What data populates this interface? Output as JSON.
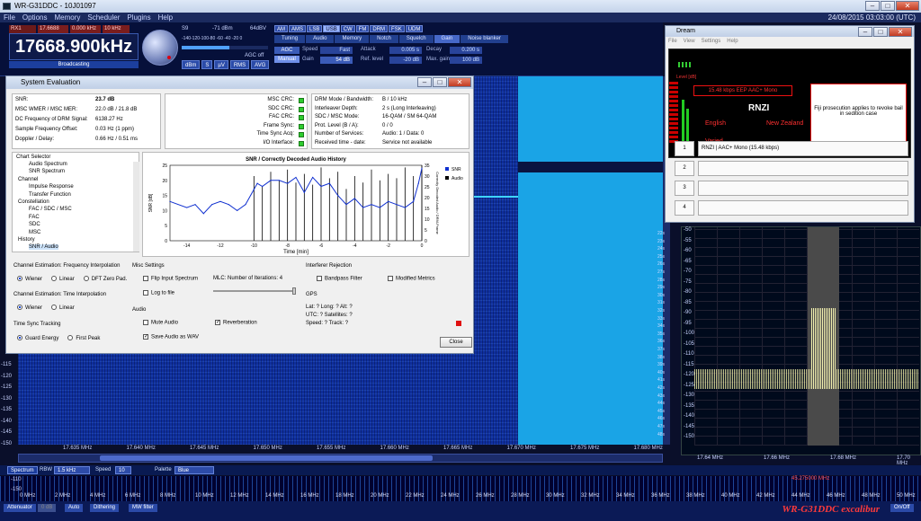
{
  "window": {
    "title": "WR-G31DDC - 10J01097"
  },
  "menu": [
    "File",
    "Options",
    "Memory",
    "Scheduler",
    "Plugins",
    "Help"
  ],
  "datetime": "24/08/2015 03:03:00 (UTC)",
  "receiver": {
    "rx": "RX1",
    "rx2": "17.6688 MHz",
    "rx3": "0.000 kHz",
    "rx4": "10 kHz",
    "frequency": "17668.900kHz",
    "state": "Broadcasting",
    "s_label": "S9",
    "dbm": "-71 dBm",
    "dbuv": "64dBV",
    "smeter_ticks": "-140-120-100-80 -60 -40 -20 0",
    "agc_off": "AGC off",
    "meter_buttons": [
      "dBm",
      "S",
      "µV",
      "RMS",
      "AVG"
    ]
  },
  "modes": [
    "AM",
    "AMS",
    "LSB",
    "USB",
    "CW",
    "FM",
    "DRM",
    "FSK",
    "UDM"
  ],
  "active_mode": "USB",
  "tabs": [
    "Tuning",
    "Audio",
    "Memory",
    "Notch",
    "Squelch",
    "Gain",
    "Noise blanker"
  ],
  "active_tab": "Gain",
  "gain": {
    "agc": "AGC",
    "manual": "Manual",
    "speed_label": "Speed",
    "speed": "Fast",
    "attack_label": "Attack",
    "attack": "0.005 s",
    "decay_label": "Decay",
    "decay": "0.200 s",
    "gain_label": "Gain",
    "gain": "54 dB",
    "reflevel_label": "Ref. level",
    "reflevel": "-20 dB",
    "maxgain_label": "Max. gain",
    "maxgain": "100 dB"
  },
  "waterfall": {
    "yticks": [
      "-115",
      "-120",
      "-125",
      "-130",
      "-135",
      "-140",
      "-145",
      "-150"
    ],
    "xticks": [
      "17.635 MHz",
      "17.640 MHz",
      "17.645 MHz",
      "17.650 MHz",
      "17.655 MHz",
      "17.660 MHz",
      "17.665 MHz",
      "17.670 MHz",
      "17.675 MHz",
      "17.680 MHz"
    ],
    "timeticks": [
      "22s",
      "23s",
      "24s",
      "25s",
      "26s",
      "27s",
      "28s",
      "29s",
      "30s",
      "31s",
      "32s",
      "33s",
      "34s",
      "35s",
      "36s",
      "37s",
      "38s",
      "39s",
      "40s",
      "41s",
      "42s",
      "43s",
      "44s",
      "45s",
      "46s",
      "47s",
      "48s"
    ]
  },
  "rightspectrum": {
    "yticks": [
      "-50",
      "-55",
      "-60",
      "-65",
      "-70",
      "-75",
      "-80",
      "-85",
      "-90",
      "-95",
      "-100",
      "-105",
      "-110",
      "-115",
      "-120",
      "-125",
      "-130",
      "-135",
      "-140",
      "-145",
      "-150"
    ],
    "xticks": [
      "17.64 MHz",
      "17.66 MHz",
      "17.68 MHz",
      "17.70 MHz"
    ]
  },
  "bottom": {
    "spectrum": "Spectrum",
    "rbw_label": "RBW",
    "rbw": "1.5 kHz",
    "speed_label": "Speed",
    "speed": "10",
    "palette_label": "Palette",
    "palette": "Blue",
    "strip_ticks": [
      "0 MHz",
      "2 MHz",
      "4 MHz",
      "6 MHz",
      "8 MHz",
      "10 MHz",
      "12 MHz",
      "14 MHz",
      "16 MHz",
      "18 MHz",
      "20 MHz",
      "22 MHz",
      "24 MHz",
      "26 MHz",
      "28 MHz",
      "30 MHz",
      "32 MHz",
      "34 MHz",
      "36 MHz",
      "38 MHz",
      "40 MHz",
      "42 MHz",
      "44 MHz",
      "46 MHz",
      "48 MHz",
      "50 MHz"
    ],
    "strip_marker": "45.275000 MHz",
    "strip_y": [
      "-110",
      "-150"
    ],
    "attenuator": "Attenuator",
    "att_val": "0 dB",
    "auto": "Auto",
    "dithering": "Dithering",
    "mwfilter": "MW filter",
    "onoff": "On/Off",
    "brand": "WR-G31DDC excalibur"
  },
  "sysdlg": {
    "title": "System Evaluation",
    "left": [
      [
        "SNR:",
        "23.7 dB"
      ],
      [
        "MSC WMER / MSC MER:",
        "22.0 dB / 21.8 dB"
      ],
      [
        "DC Frequency of DRM Signal:",
        "6138.27 Hz"
      ],
      [
        "Sample Frequency Offset:",
        "0.03 Hz (1 ppm)"
      ],
      [
        "Doppler / Delay:",
        "0.66 Hz / 0.51 ms"
      ]
    ],
    "crc": [
      "MSC CRC:",
      "SDC CRC:",
      "FAC CRC:",
      "Frame Sync:",
      "Time Sync Acq:",
      "I/O Interface:"
    ],
    "right": [
      [
        "DRM Mode / Bandwidth:",
        "B / 10 kHz"
      ],
      [
        "Interleaver Depth:",
        "2 s (Long Interleaving)"
      ],
      [
        "SDC / MSC Mode:",
        "16-QAM / SM 64-QAM"
      ],
      [
        "Prot. Level (B / A):",
        "0 / 0"
      ],
      [
        "Number of Services:",
        "Audio: 1 / Data: 0"
      ],
      [
        "Received time - date:",
        "Service not available"
      ]
    ],
    "tree_title": "Chart Selector",
    "tree": [
      "Audio Spectrum",
      "SNR Spectrum",
      "Channel",
      "Impulse Response",
      "Transfer Function",
      "Constellation",
      "FAC / SDC / MSC",
      "FAC",
      "SDC",
      "MSC",
      "History",
      "SNR / Audio"
    ],
    "chart": {
      "title": "SNR / Correctly Decoded Audio History",
      "ylabel": "SNR [dB]",
      "ylabel2": "Correctly Decoded Audio / DRM-Frame",
      "xlabel": "Time [min]",
      "legend": [
        "SNR",
        "Audio"
      ]
    },
    "fi_title": "Channel Estimation: Frequency Interpolation",
    "fi": [
      "Wiener",
      "Linear",
      "DFT Zero Pad."
    ],
    "ti_title": "Channel Estimation: Time Interpolation",
    "ti": [
      "Wiener",
      "Linear"
    ],
    "ts_title": "Time Sync Tracking",
    "ts": [
      "Guard Energy",
      "First Peak"
    ],
    "misc_title": "Misc Settings",
    "flip": "Flip Input Spectrum",
    "log": "Log to file",
    "mlc": "MLC: Number of Iterations: 4",
    "audio_title": "Audio",
    "mute": "Mute Audio",
    "reverb": "Reverberation",
    "save": "Save Audio as WAV",
    "ir_title": "Interferer Rejection",
    "bandpass": "Bandpass Filter",
    "modmetrics": "Modified Metrics",
    "gps_title": "GPS",
    "gps": [
      "Lat: ?  Long: ?  Alt: ?",
      "UTC: ?  Satellites: ?",
      "Speed: ?  Track: ?"
    ],
    "close": "Close"
  },
  "dream": {
    "title": "Dream",
    "menu": [
      "File",
      "View",
      "Settings",
      "Help"
    ],
    "bitrate": "15.48 kbps EEP  AAC+  Mono",
    "station": "RNZI",
    "lang": "English",
    "country": "New Zealand",
    "varied": "Varied",
    "level": "Level [dB]",
    "news": "Fiji prosecution applies to revoke bail in sedition case",
    "services": [
      {
        "n": "1",
        "t": "RNZI  |  AAC+ Mono (15.48 kbps)"
      },
      {
        "n": "2",
        "t": ""
      },
      {
        "n": "3",
        "t": ""
      },
      {
        "n": "4",
        "t": ""
      }
    ]
  },
  "chart_data": {
    "type": "line",
    "title": "SNR / Correctly Decoded Audio History",
    "xlabel": "Time [min]",
    "ylabel": "SNR [dB]",
    "xlim": [
      -15,
      0
    ],
    "ylim": [
      0,
      25
    ],
    "y2lim": [
      0,
      35
    ],
    "series": [
      {
        "name": "SNR",
        "x": [
          -15,
          -14,
          -13.5,
          -13,
          -12.5,
          -12,
          -11.5,
          -11,
          -10.5,
          -10,
          -9.8,
          -9.5,
          -9,
          -8.5,
          -8,
          -7.5,
          -7,
          -6.5,
          -6,
          -5.5,
          -5,
          -4.5,
          -4,
          -3.5,
          -3,
          -2.5,
          -2,
          -1.5,
          -1,
          -0.5,
          -0.2,
          0
        ],
        "y": [
          13,
          11,
          12,
          9,
          12,
          13,
          12,
          10,
          12,
          17,
          19,
          18,
          20,
          20,
          19,
          21,
          16,
          21,
          18,
          19,
          15,
          12,
          14,
          11,
          12,
          11,
          13,
          12,
          11,
          13,
          19,
          24
        ]
      },
      {
        "name": "Audio",
        "x": [
          -10,
          -9.5,
          -9,
          -8.5,
          -8,
          -7.5,
          -7,
          -6.5,
          -6,
          -5.5,
          -5,
          -4.5,
          -4,
          -3.5,
          -3,
          -2.5,
          -2,
          -1.5,
          -1,
          -0.5,
          0
        ],
        "y": [
          30,
          25,
          32,
          28,
          33,
          27,
          31,
          26,
          34,
          29,
          32,
          24,
          30,
          27,
          33,
          28,
          31,
          29,
          34,
          30,
          35
        ]
      }
    ]
  }
}
